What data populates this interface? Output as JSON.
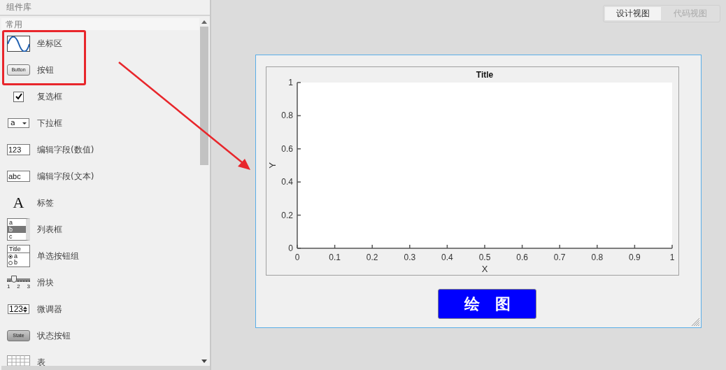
{
  "panel": {
    "title": "组件库",
    "section": "常用",
    "items": [
      {
        "kind": "axes",
        "label": "坐标区"
      },
      {
        "kind": "button",
        "label": "按钮",
        "icon_texts": [
          "Button"
        ]
      },
      {
        "kind": "checkbox",
        "label": "复选框"
      },
      {
        "kind": "dropdown",
        "label": "下拉框",
        "icon_texts": [
          "a"
        ]
      },
      {
        "kind": "field",
        "label": "编辑字段(数值)",
        "icon_texts": [
          "123"
        ]
      },
      {
        "kind": "field",
        "label": "编辑字段(文本)",
        "icon_texts": [
          "abc"
        ]
      },
      {
        "kind": "label",
        "label": "标签",
        "icon_texts": [
          "A"
        ]
      },
      {
        "kind": "listbox",
        "label": "列表框",
        "icon_texts": [
          "a",
          "b",
          "c"
        ]
      },
      {
        "kind": "radio-group",
        "label": "单选按钮组",
        "icon_texts": [
          "Title",
          "a",
          "b"
        ]
      },
      {
        "kind": "slider",
        "label": "滑块",
        "icon_texts": [
          "1",
          "2",
          "3"
        ]
      },
      {
        "kind": "spinner",
        "label": "微调器",
        "icon_texts": [
          "123"
        ]
      },
      {
        "kind": "state-button",
        "label": "状态按钮",
        "icon_texts": [
          "State"
        ]
      },
      {
        "kind": "table",
        "label": "表"
      }
    ]
  },
  "view_tabs": [
    {
      "label": "设计视图",
      "selected": true
    },
    {
      "label": "代码视图",
      "selected": false
    }
  ],
  "figure": {
    "axes": {
      "chart_data": {
        "type": "line",
        "title": "Title",
        "xlabel": "X",
        "ylabel": "Y",
        "xlim": [
          0,
          1
        ],
        "ylim": [
          0,
          1
        ],
        "xticks": [
          0,
          {
            "value": 0.1,
            "label": "0.1"
          },
          {
            "value": 0.2,
            "label": "0.2"
          },
          {
            "value": 0.3,
            "label": "0.3"
          },
          {
            "value": 0.4,
            "label": "0.4"
          },
          {
            "value": 0.5,
            "label": "0.5"
          },
          {
            "value": 0.6,
            "label": "0.6"
          },
          {
            "value": 0.7,
            "label": "0.7"
          },
          {
            "value": 0.8,
            "label": "0.8"
          },
          {
            "value": 0.9,
            "label": "0.9"
          },
          1
        ],
        "yticks": [
          0,
          {
            "value": 0.2,
            "label": "0.2"
          },
          {
            "value": 0.4,
            "label": "0.4"
          },
          {
            "value": 0.6,
            "label": "0.6"
          },
          {
            "value": 0.8,
            "label": "0.8"
          },
          1
        ]
      }
    },
    "button": {
      "label": "绘　图"
    }
  }
}
